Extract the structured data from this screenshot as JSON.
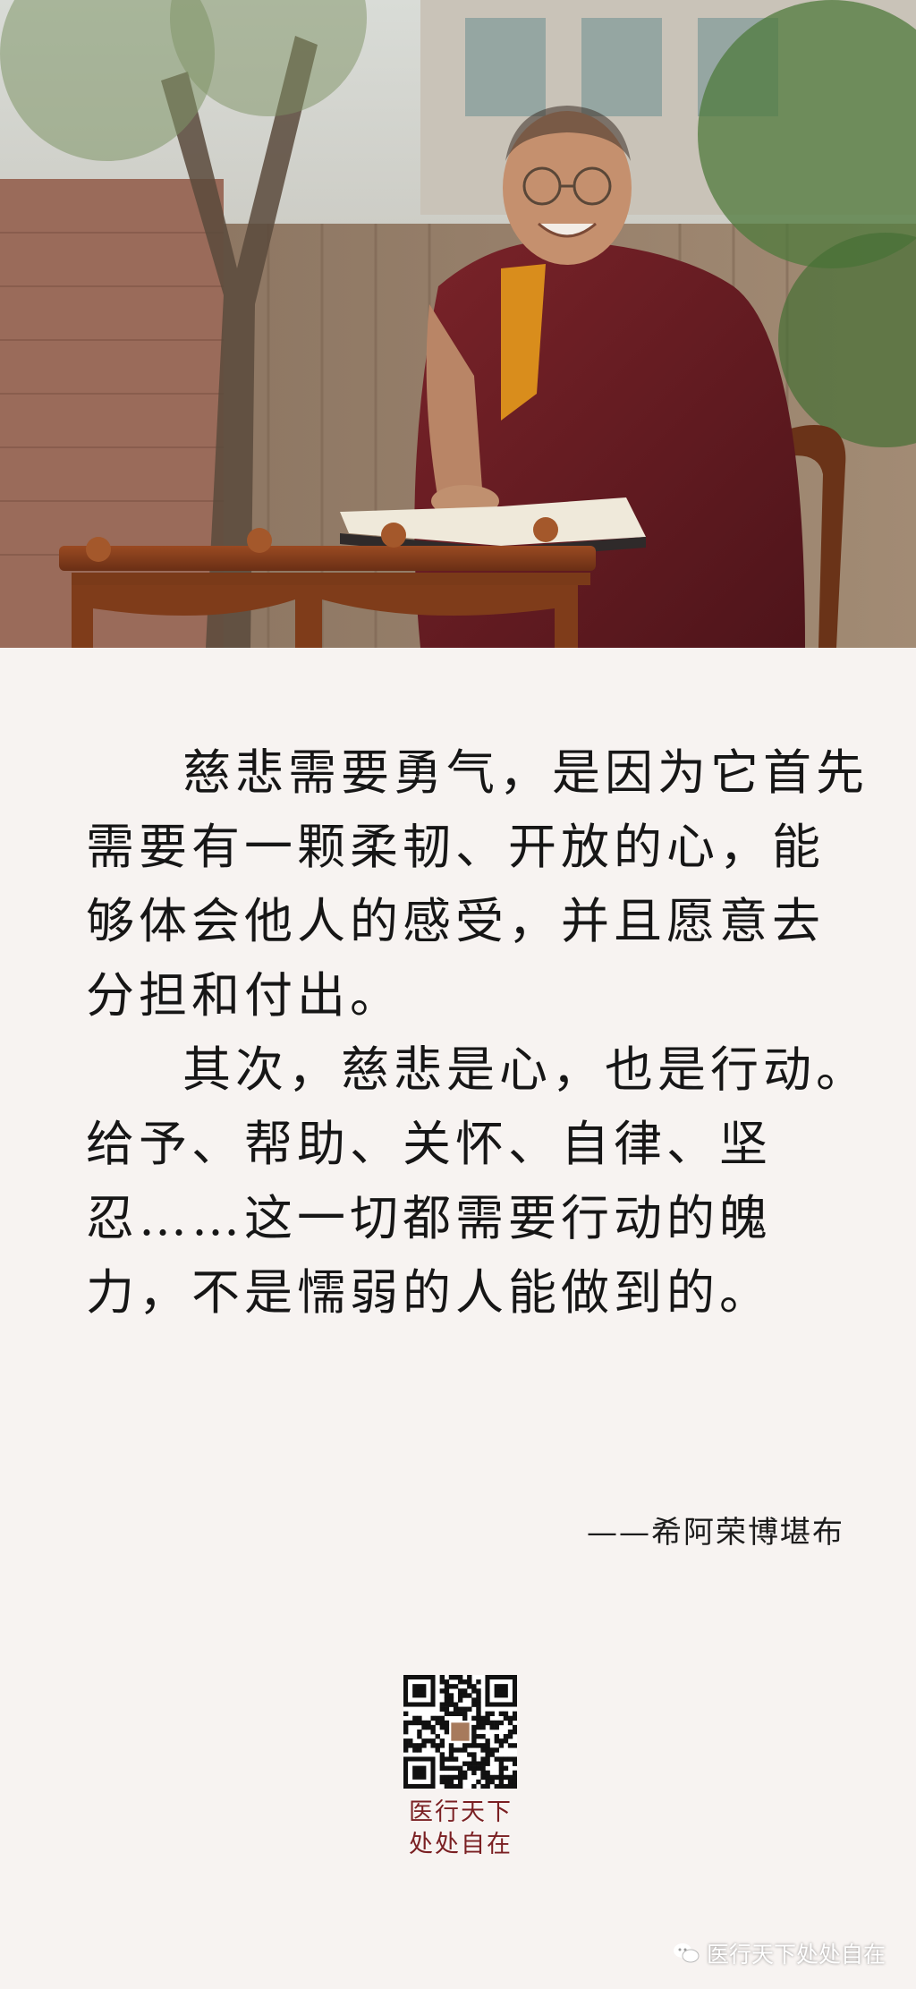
{
  "quote": {
    "paragraphs": [
      "慈悲需要勇气，是因为它首先需要有一颗柔韧、开放的心，能够体会他人的感受，并且愿意去分担和付出。",
      "其次，慈悲是心，也是行动。给予、帮助、关怀、自律、坚忍……这一切都需要行动的魄力，不是懦弱的人能做到的。"
    ]
  },
  "author": "——希阿荣博堪布",
  "brand": {
    "line1": "医行天下",
    "line2": "处处自在"
  },
  "watermark": {
    "text": "医行天下处处自在",
    "icon": "wechat-icon"
  },
  "icons": {
    "qr": "qr-code-icon"
  },
  "colors": {
    "background": "#f7f3f1",
    "text": "#161616",
    "brand": "#7a1f22",
    "robe": "#6b1f24"
  }
}
